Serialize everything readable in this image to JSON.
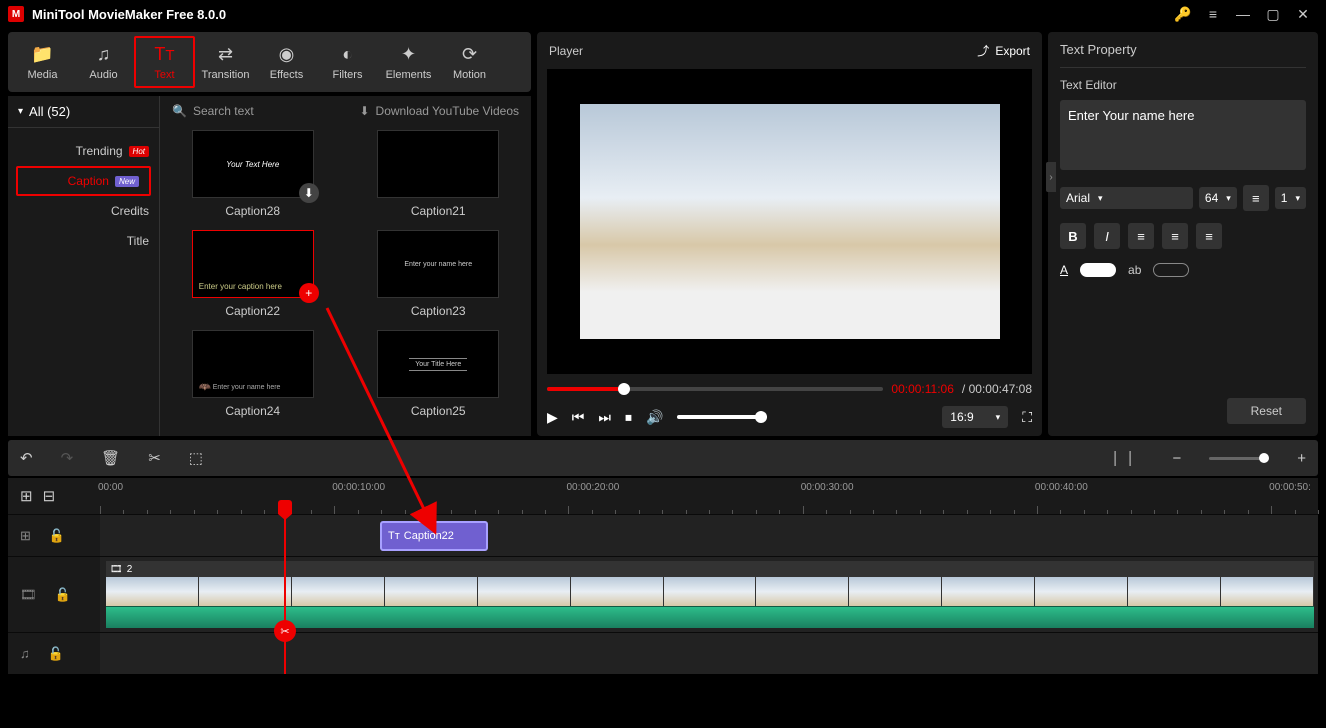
{
  "app": {
    "title": "MiniTool MovieMaker Free 8.0.0"
  },
  "toolbar": {
    "tabs": [
      "Media",
      "Audio",
      "Text",
      "Transition",
      "Effects",
      "Filters",
      "Elements",
      "Motion"
    ],
    "active": "Text"
  },
  "categories": {
    "header": "All (52)",
    "items": [
      {
        "label": "Trending",
        "badge": "Hot"
      },
      {
        "label": "Caption",
        "badge": "New"
      },
      {
        "label": "Credits"
      },
      {
        "label": "Title"
      }
    ],
    "selected": "Caption"
  },
  "search": {
    "placeholder": "Search text",
    "download_link": "Download YouTube Videos"
  },
  "thumbs": [
    {
      "name": "Caption28",
      "hint": "Your Text Here",
      "download": true
    },
    {
      "name": "Caption21",
      "hint": ""
    },
    {
      "name": "Caption22",
      "hint": "Enter your caption here",
      "selected": true,
      "add": true
    },
    {
      "name": "Caption23",
      "hint": "Enter your name here"
    },
    {
      "name": "Caption24",
      "hint": "Enter your name here"
    },
    {
      "name": "Caption25",
      "hint": "Your Title Here"
    }
  ],
  "player": {
    "title": "Player",
    "export": "Export",
    "current_time": "00:00:11:06",
    "total_time": "00:00:47:08",
    "time_sep": " / ",
    "ratio": "16:9"
  },
  "text_property": {
    "title": "Text Property",
    "editor_label": "Text Editor",
    "content": "Enter Your name here",
    "font": "Arial",
    "size": "64",
    "spacing": "1",
    "reset": "Reset"
  },
  "timeline": {
    "ruler": [
      "00:00",
      "00:00:10:00",
      "00:00:20:00",
      "00:00:30:00",
      "00:00:40:00",
      "00:00:50:"
    ],
    "caption_clip": "Caption22",
    "video_count": "2"
  }
}
